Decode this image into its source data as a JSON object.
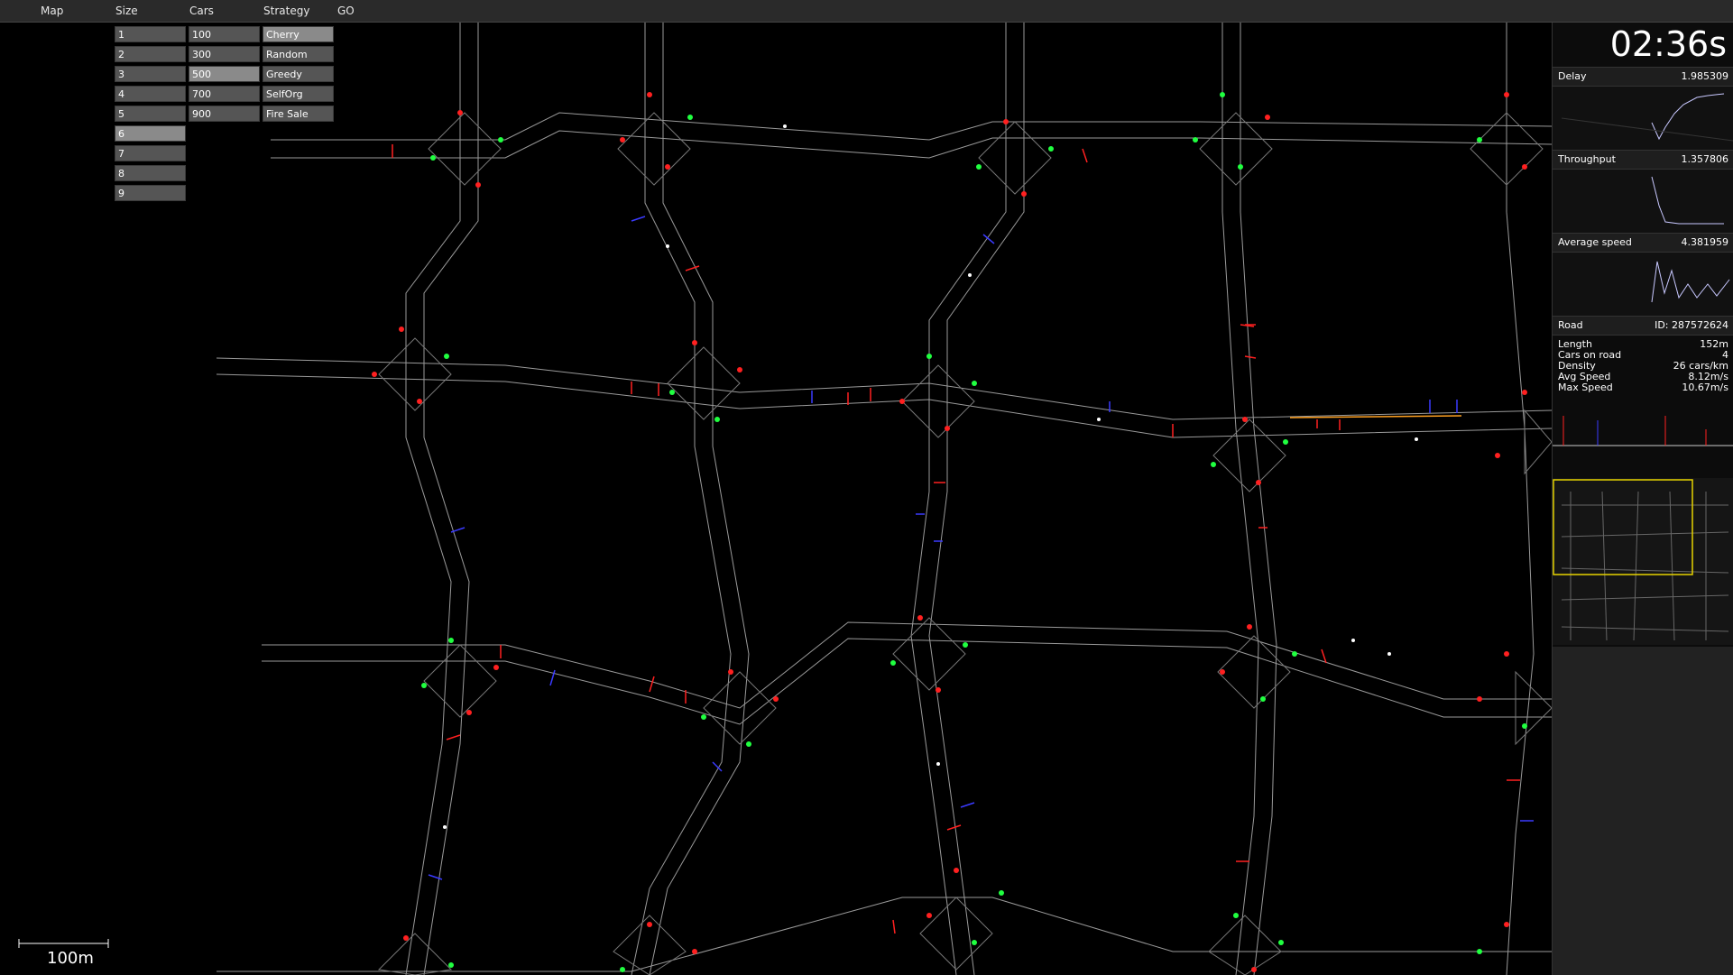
{
  "menu": {
    "map": "Map",
    "size": "Size",
    "cars": "Cars",
    "strategy": "Strategy",
    "go": "GO"
  },
  "size_options": [
    "1",
    "2",
    "3",
    "4",
    "5",
    "6",
    "7",
    "8",
    "9"
  ],
  "size_selected": "6",
  "cars_options": [
    "100",
    "300",
    "500",
    "700",
    "900"
  ],
  "cars_selected": "500",
  "strategy_options": [
    "Cherry",
    "Random",
    "Greedy",
    "SelfOrg",
    "Fire Sale"
  ],
  "strategy_selected": "Cherry",
  "timer": "02:36s",
  "stats": {
    "delay_label": "Delay",
    "delay_value": "1.985309",
    "throughput_label": "Throughput",
    "throughput_value": "1.357806",
    "avg_speed_label": "Average speed",
    "avg_speed_value": "4.381959"
  },
  "road": {
    "header_label": "Road",
    "id_text": "ID: 287572624",
    "rows": [
      {
        "label": "Length",
        "value": "152m"
      },
      {
        "label": "Cars on road",
        "value": "4"
      },
      {
        "label": "Density",
        "value": "26 cars/km"
      },
      {
        "label": "Avg Speed",
        "value": "8.12m/s"
      },
      {
        "label": "Max Speed",
        "value": "10.67m/s"
      }
    ]
  },
  "scale_label": "100m",
  "colors": {
    "road_line": "#9a9a9a",
    "signal_red": "#ff2020",
    "signal_green": "#20ff40",
    "car_blue": "#3a3aff",
    "highlight_orange": "#ffa020",
    "minimap_frame": "#e6d300"
  }
}
